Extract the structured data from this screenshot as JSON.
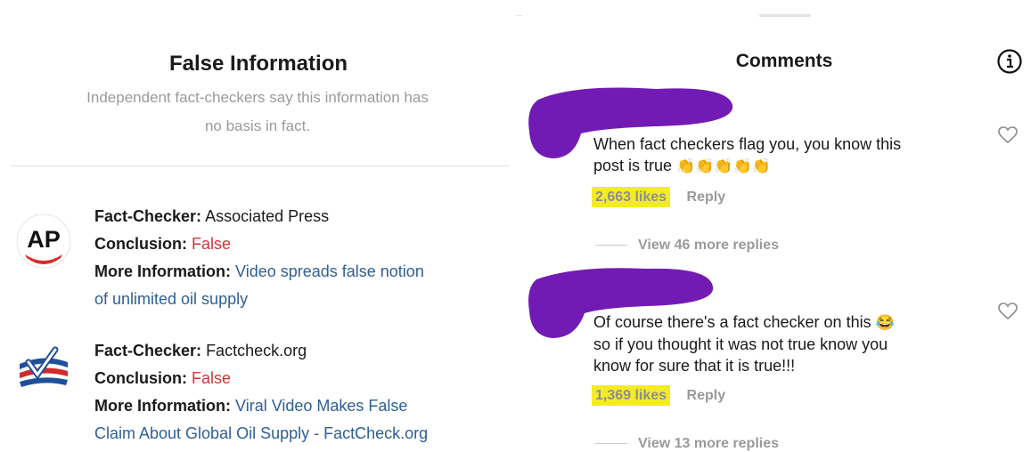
{
  "false_info": {
    "title": "False Information",
    "subtitle_line1": "Independent fact-checkers say this information has",
    "subtitle_line2": "no basis in fact."
  },
  "fact_checks": [
    {
      "logo_icon": "ap-logo",
      "checker_label": "Fact-Checker:",
      "checker": "Associated Press",
      "conclusion_label": "Conclusion:",
      "conclusion": "False",
      "more_label": "More Information:",
      "link_line1": "Video spreads false notion",
      "link_line2": "of unlimited oil supply"
    },
    {
      "logo_icon": "factcheck-org-logo",
      "checker_label": "Fact-Checker:",
      "checker": "Factcheck.org",
      "conclusion_label": "Conclusion:",
      "conclusion": "False",
      "more_label": "More Information:",
      "link_line1": "Viral Video Makes False",
      "link_line2": "Claim About Global Oil Supply - FactCheck.org"
    }
  ],
  "comments_panel": {
    "title": "Comments",
    "info_icon": "info-icon",
    "comments": [
      {
        "line1": "When fact checkers flag you, you know this",
        "line2": "post is true",
        "emoji": "👏👏👏👏👏",
        "likes": "2,663 likes",
        "reply": "Reply",
        "view_more": "View 46 more replies"
      },
      {
        "line1": "Of course there's a fact checker on this",
        "line1_emoji": "😂",
        "line2": "so if you thought it was not true know you",
        "line3": "know for sure that it is true!!!",
        "likes": "1,369 likes",
        "reply": "Reply",
        "view_more": "View 13 more replies"
      }
    ]
  },
  "colors": {
    "false_red": "#d0343a",
    "link_blue": "#2f5f94",
    "highlight_yellow": "#f3ec25",
    "redaction_purple": "#6a0fb0"
  }
}
